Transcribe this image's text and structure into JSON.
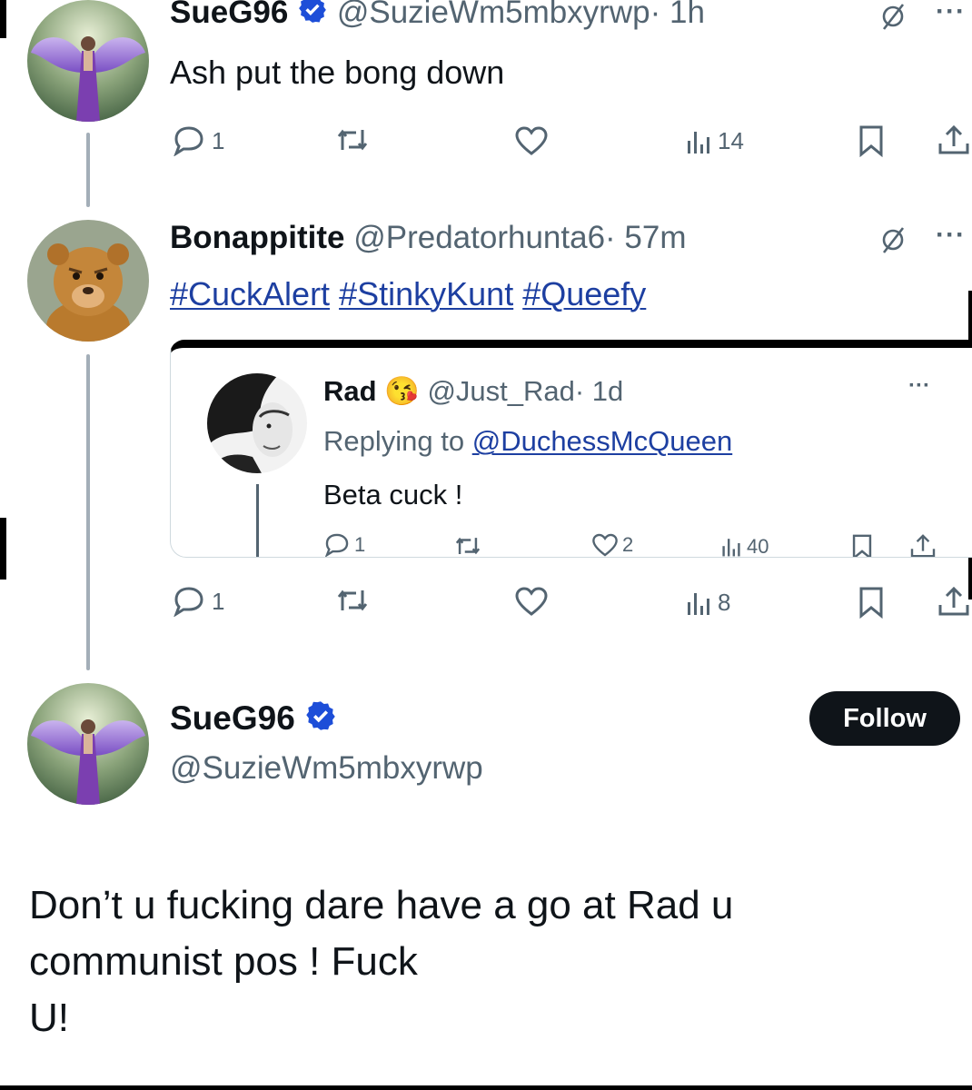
{
  "tweet1": {
    "name": "SueG96",
    "handle": "@SuzieWm5mbxyrwp",
    "time": "· 1h",
    "text": "Ash put the bong down",
    "replies": "1",
    "views": "14"
  },
  "tweet2": {
    "name": "Bonappitite",
    "handle": "@Predatorhunta6",
    "time": "· 57m",
    "hashtags": [
      "#CuckAlert",
      "#StinkyKunt",
      "#Queefy"
    ],
    "replies": "1",
    "views": "8",
    "quote": {
      "name": "Rad",
      "emoji": "😘",
      "handle": "@Just_Rad",
      "time": "· 1d",
      "replying_prefix": "Replying to",
      "replying_to": "@DuchessMcQueen",
      "text": "Beta cuck !",
      "replies": "1",
      "likes": "2",
      "views": "40"
    }
  },
  "tweet3": {
    "name": "SueG96",
    "handle": "@SuzieWm5mbxyrwp",
    "follow_label": "Follow",
    "text_lines": [
      "Don’t u fucking dare have a go at Rad u",
      "communist pos ! Fuck",
      "U!"
    ]
  },
  "colors": {
    "text": "#0f1419",
    "muted": "#536471",
    "verified": "#1d4ed8",
    "hashtag": "#1d3fa1",
    "follow_bg": "#0f1419"
  },
  "icons": [
    "reply-icon",
    "retweet-icon",
    "like-icon",
    "views-icon",
    "bookmark-icon",
    "share-icon",
    "verified-badge-icon",
    "grok-icon",
    "more-icon"
  ]
}
